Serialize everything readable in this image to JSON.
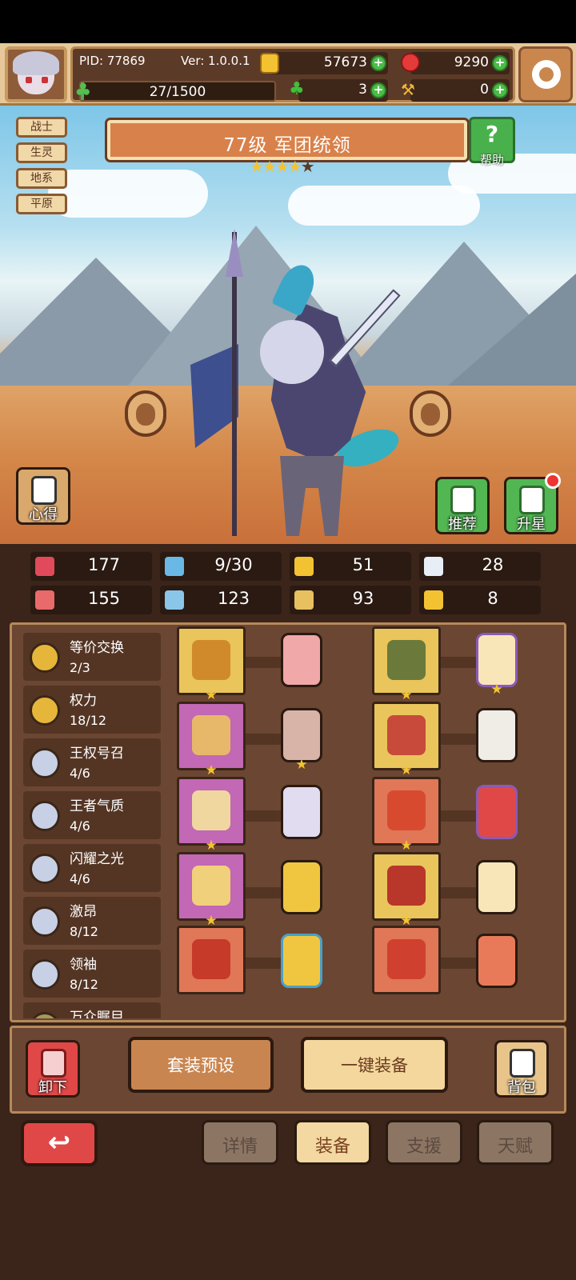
{
  "header": {
    "pid": "PID: 77869",
    "version": "Ver: 1.0.0.1",
    "gold": "57673",
    "gems": "9290",
    "clover": "3",
    "hammer": "0",
    "exp_text": "27/1500",
    "exp_progress": 0.018
  },
  "tags": [
    "战士",
    "生灵",
    "地系",
    "平原"
  ],
  "hero": {
    "title": "77级 军团统领",
    "stars_filled": 4,
    "stars_total": 5
  },
  "buttons": {
    "help": "帮助",
    "notes": "心得",
    "recommend": "推荐",
    "star_up": "升星",
    "unequip": "卸下",
    "preset": "套装预设",
    "equip_all": "一键装备",
    "bag": "背包"
  },
  "stats": [
    {
      "icon": "heart-icon",
      "value": "177",
      "color": "#e04a5a"
    },
    {
      "icon": "droplet-icon",
      "value": "9/30",
      "color": "#6ab8e6"
    },
    {
      "icon": "shield-icon",
      "value": "51",
      "color": "#f2c232"
    },
    {
      "icon": "wing-icon",
      "value": "28",
      "color": "#e8eef6"
    },
    {
      "icon": "fist-icon",
      "value": "155",
      "color": "#e86a6a"
    },
    {
      "icon": "book-icon",
      "value": "123",
      "color": "#8ac6e8"
    },
    {
      "icon": "flag-icon",
      "value": "93",
      "color": "#e8c060"
    },
    {
      "icon": "horseshoe-icon",
      "value": "8",
      "color": "#f2c232"
    }
  ],
  "sets": [
    {
      "name": "等价交换",
      "count": "2/3",
      "medal": "gold"
    },
    {
      "name": "权力",
      "count": "18/12",
      "medal": "gold"
    },
    {
      "name": "王权号召",
      "count": "4/6",
      "medal": "silver"
    },
    {
      "name": "王者气质",
      "count": "4/6",
      "medal": "silver"
    },
    {
      "name": "闪耀之光",
      "count": "4/6",
      "medal": "silver"
    },
    {
      "name": "激昂",
      "count": "8/12",
      "medal": "silver"
    },
    {
      "name": "领袖",
      "count": "8/12",
      "medal": "silver"
    },
    {
      "name": "万众瞩目",
      "count": "",
      "medal": "olive"
    }
  ],
  "tabs": [
    "详情",
    "装备",
    "支援",
    "天赋"
  ],
  "active_tab": "装备",
  "colors": {
    "accent_red": "#e04848",
    "panel_brown": "#6b4632",
    "gold": "#f2c232"
  }
}
